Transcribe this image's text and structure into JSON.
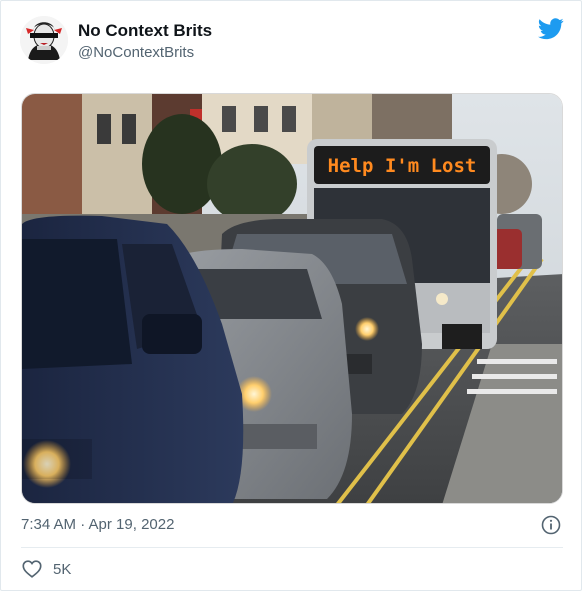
{
  "author": {
    "display_name": "No Context Brits",
    "handle": "@NoContextBrits",
    "avatar_icon": "queen-portrait-avatar"
  },
  "brand": {
    "icon": "twitter-bird-icon",
    "color": "#1d9bf0"
  },
  "media": {
    "bus_sign_text": "Help I'm Lost",
    "bus_sign_color": "#ff8a1f"
  },
  "timestamp": "7:34 AM · Apr 19, 2022",
  "likes": {
    "count": "5K",
    "icon": "heart-icon"
  },
  "info_icon": "info-icon"
}
